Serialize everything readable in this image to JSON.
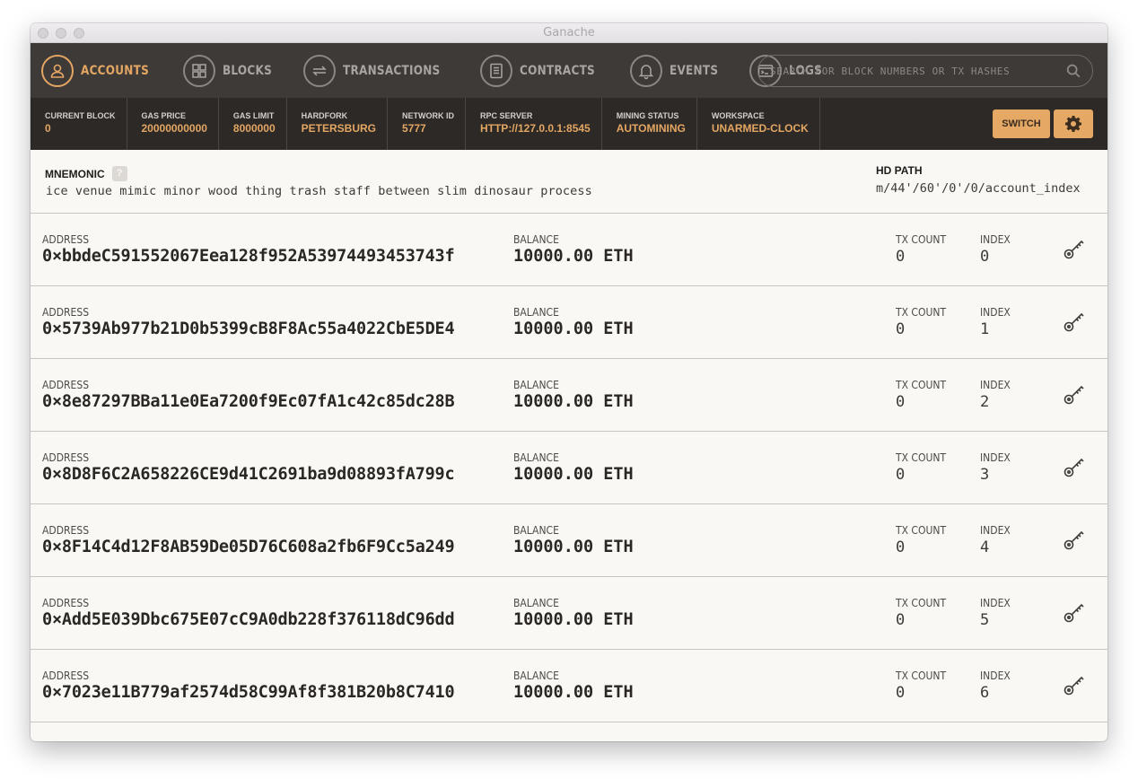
{
  "window": {
    "title": "Ganache"
  },
  "nav": {
    "items": [
      {
        "label": "ACCOUNTS",
        "icon": "person-icon",
        "active": true
      },
      {
        "label": "BLOCKS",
        "icon": "grid-icon",
        "active": false
      },
      {
        "label": "TRANSACTIONS",
        "icon": "arrows-icon",
        "active": false
      },
      {
        "label": "CONTRACTS",
        "icon": "document-icon",
        "active": false
      },
      {
        "label": "EVENTS",
        "icon": "bell-icon",
        "active": false
      },
      {
        "label": "LOGS",
        "icon": "terminal-icon",
        "active": false
      }
    ],
    "search_placeholder": "SEARCH FOR BLOCK NUMBERS OR TX HASHES"
  },
  "status": {
    "current_block": {
      "label": "CURRENT BLOCK",
      "value": "0"
    },
    "gas_price": {
      "label": "GAS PRICE",
      "value": "20000000000"
    },
    "gas_limit": {
      "label": "GAS LIMIT",
      "value": "8000000"
    },
    "hardfork": {
      "label": "HARDFORK",
      "value": "PETERSBURG"
    },
    "network_id": {
      "label": "NETWORK ID",
      "value": "5777"
    },
    "rpc_server": {
      "label": "RPC SERVER",
      "value": "HTTP://127.0.0.1:8545"
    },
    "mining_status": {
      "label": "MINING STATUS",
      "value": "AUTOMINING"
    },
    "workspace": {
      "label": "WORKSPACE",
      "value": "UNARMED-CLOCK"
    },
    "switch_label": "SWITCH"
  },
  "mnemonic": {
    "label": "MNEMONIC",
    "help": "?",
    "value": "ice venue mimic minor wood thing trash staff between slim dinosaur process",
    "hd_path_label": "HD PATH",
    "hd_path_value": "m/44'/60'/0'/0/account_index"
  },
  "labels": {
    "address": "ADDRESS",
    "balance": "BALANCE",
    "tx_count": "TX COUNT",
    "index": "INDEX"
  },
  "accounts": [
    {
      "address": "0×bbdeC591552067Eea128f952A53974493453743f",
      "balance": "10000.00 ETH",
      "tx_count": "0",
      "index": "0"
    },
    {
      "address": "0×5739Ab977b21D0b5399cB8F8Ac55a4022CbE5DE4",
      "balance": "10000.00 ETH",
      "tx_count": "0",
      "index": "1"
    },
    {
      "address": "0×8e87297BBa11e0Ea7200f9Ec07fA1c42c85dc28B",
      "balance": "10000.00 ETH",
      "tx_count": "0",
      "index": "2"
    },
    {
      "address": "0×8D8F6C2A658226CE9d41C2691ba9d08893fA799c",
      "balance": "10000.00 ETH",
      "tx_count": "0",
      "index": "3"
    },
    {
      "address": "0×8F14C4d12F8AB59De05D76C608a2fb6F9Cc5a249",
      "balance": "10000.00 ETH",
      "tx_count": "0",
      "index": "4"
    },
    {
      "address": "0×Add5E039Dbc675E07cC9A0db228f376118dC96dd",
      "balance": "10000.00 ETH",
      "tx_count": "0",
      "index": "5"
    },
    {
      "address": "0×7023e11B779af2574d58C99Af8f381B20b8C7410",
      "balance": "10000.00 ETH",
      "tx_count": "0",
      "index": "6"
    }
  ],
  "colors": {
    "accent": "#e4a663",
    "nav_bg": "#3e3a37",
    "status_bg": "#2c2926",
    "content_bg": "#faf8f4"
  }
}
